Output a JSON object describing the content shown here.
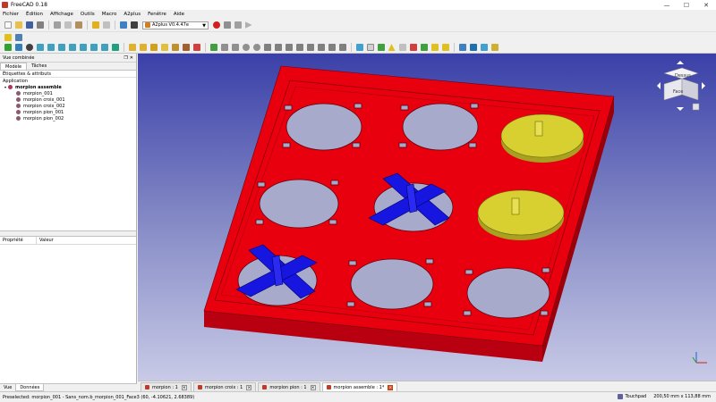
{
  "window": {
    "title": "FreeCAD 0.18"
  },
  "menu": [
    "Fichier",
    "Édition",
    "Affichage",
    "Outils",
    "Macro",
    "A2plus",
    "Fenêtre",
    "Aide"
  ],
  "workbench": {
    "selected": "A2plus V0.4.47e"
  },
  "combo_view": {
    "title": "Vue combinée",
    "tabs": [
      "Modèle",
      "Tâches"
    ],
    "labels_header": "Étiquettes & attributs",
    "root": "Application",
    "tree": {
      "assembly": "morpion assemble",
      "children": [
        "morpion_001",
        "morpion croix_001",
        "morpion croix_002",
        "morpion pion_001",
        "morpion pion_002"
      ]
    },
    "property_columns": [
      "Propriété",
      "Valeur"
    ],
    "bottom_tabs": [
      "Vue",
      "Données"
    ]
  },
  "navcube": {
    "top": "Dessus",
    "front": "Face"
  },
  "doc_tabs": [
    {
      "label": "morpion : 1",
      "active": false
    },
    {
      "label": "morpion croix : 1",
      "active": false
    },
    {
      "label": "morpion pion : 1",
      "active": false
    },
    {
      "label": "morpion assemble : 1*",
      "active": true
    }
  ],
  "status": {
    "message": "Preselected: morpion_001 - Sans_nom.b_morpion_001_Face3 (60, -4.10621, 2.68389)",
    "nav_style": "Touchpad",
    "dimensions": "200,50 mm x 113,88 mm"
  },
  "colors": {
    "board": "#e8000e",
    "cross": "#1616e0",
    "pawn": "#d8d030",
    "viewport_top": "#3a40a8",
    "viewport_bottom": "#c8cae6"
  }
}
